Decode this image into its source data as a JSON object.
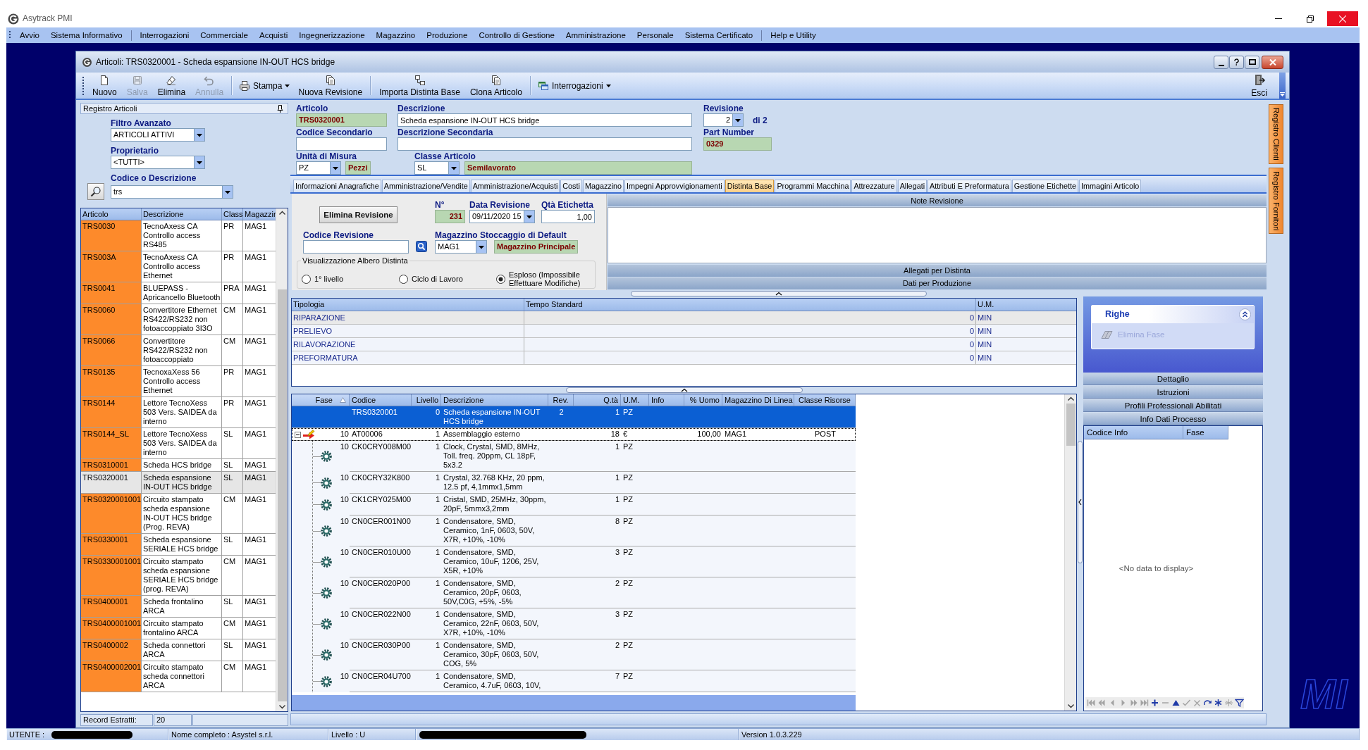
{
  "app": {
    "title": "Asytrack PMI"
  },
  "menu": [
    [
      "Avvio",
      "Sistema Informativo"
    ],
    [
      "Interrogazioni",
      "Commerciale",
      "Acquisti",
      "Ingegnerizzazione",
      "Magazzino",
      "Produzione",
      "Controllo di Gestione",
      "Amministrazione",
      "Personale",
      "Sistema Certificato"
    ],
    [
      "Help e Utility"
    ]
  ],
  "desktop_logo": "MI",
  "window": {
    "title": "Articoli: TRS0320001 - Scheda espansione IN-OUT HCS bridge"
  },
  "toolbar": {
    "groups": [
      [
        {
          "label": "Nuovo",
          "kind": "button",
          "disabled": false
        },
        {
          "label": "Salva",
          "kind": "button",
          "disabled": true
        },
        {
          "label": "Elimina",
          "kind": "button",
          "disabled": false
        },
        {
          "label": "Annulla",
          "kind": "button",
          "disabled": true
        }
      ],
      [
        {
          "label": "Stampa",
          "kind": "dropdown",
          "disabled": false
        },
        {
          "label": "Nuova Revisione",
          "kind": "button",
          "disabled": false
        }
      ],
      [
        {
          "label": "Importa Distinta Base",
          "kind": "button",
          "disabled": false
        },
        {
          "label": "Clona Articolo",
          "kind": "button",
          "disabled": false
        }
      ],
      [
        {
          "label": "Interrogazioni",
          "kind": "dropdown",
          "disabled": false
        }
      ]
    ],
    "exit": "Esci"
  },
  "registry": {
    "title": "Registro Articoli",
    "filters": [
      {
        "kind": "combo",
        "label": "Filtro Avanzato",
        "value": "ARTICOLI ATTIVI"
      },
      {
        "kind": "combo",
        "label": "Proprietario",
        "value": "<TUTTI>"
      },
      {
        "kind": "search",
        "label": "Codice o Descrizione",
        "value": "trs"
      }
    ],
    "columns": [
      "Articolo",
      "Descrizione",
      "Class",
      "Magazzir"
    ],
    "rows": [
      {
        "code": "TRS0030",
        "description": "TecnoAxess CA Controllo access RS485",
        "class_code": "PR",
        "warehouse": "MAG1",
        "selected": false
      },
      {
        "code": "TRS003A",
        "description": "TecnoAxess CA Controllo access Ethernet",
        "class_code": "PR",
        "warehouse": "MAG1",
        "selected": false
      },
      {
        "code": "TRS0041",
        "description": "BLUEPASS - Apricancello Bluetooth",
        "class_code": "PRA",
        "warehouse": "MAG1",
        "selected": false
      },
      {
        "code": "TRS0060",
        "description": "Convertitore Ethernet RS422/RS232 non fotoaccoppiato 3I3O",
        "class_code": "CM",
        "warehouse": "MAG1",
        "selected": false
      },
      {
        "code": "TRS0066",
        "description": "Convertitore RS422/RS232 non fotoaccoppiato",
        "class_code": "CM",
        "warehouse": "MAG1",
        "selected": false
      },
      {
        "code": "TRS0135",
        "description": "TecnoxaXess 56 Controllo access Ethernet",
        "class_code": "PR",
        "warehouse": "MAG1",
        "selected": false
      },
      {
        "code": "TRS0144",
        "description": "Lettore TecnoXess 503 Vers. SAIDEA da interno",
        "class_code": "PR",
        "warehouse": "MAG1",
        "selected": false
      },
      {
        "code": "TRS0144_SL",
        "description": "Lettore TecnoXess 503 Vers. SAIDEA da interno",
        "class_code": "SL",
        "warehouse": "MAG1",
        "selected": false
      },
      {
        "code": "TRS0310001",
        "description": "Scheda HCS bridge",
        "class_code": "SL",
        "warehouse": "MAG1",
        "selected": false
      },
      {
        "code": "TRS0320001",
        "description": "Scheda espansione IN-OUT HCS bridge",
        "class_code": "SL",
        "warehouse": "MAG1",
        "selected": true
      },
      {
        "code": "TRS0320001001",
        "description": "Circuito stampato scheda espansione IN-OUT HCS bridge (Prog. REVA)",
        "class_code": "CM",
        "warehouse": "MAG1",
        "selected": false
      },
      {
        "code": "TRS0330001",
        "description": "Scheda espansione SERIALE HCS bridge",
        "class_code": "SL",
        "warehouse": "MAG1",
        "selected": false
      },
      {
        "code": "TRS0330001001",
        "description": "Circuito stampato scheda espansione SERIALE HCS bridge (prog. REVA)",
        "class_code": "CM",
        "warehouse": "MAG1",
        "selected": false
      },
      {
        "code": "TRS0400001",
        "description": "Scheda frontalino ARCA",
        "class_code": "SL",
        "warehouse": "MAG1",
        "selected": false
      },
      {
        "code": "TRS0400001001",
        "description": "Circuito stampato frontalino ARCA",
        "class_code": "CM",
        "warehouse": "MAG1",
        "selected": false
      },
      {
        "code": "TRS0400002",
        "description": "Scheda connettori ARCA",
        "class_code": "SL",
        "warehouse": "MAG1",
        "selected": false
      },
      {
        "code": "TRS0400002001",
        "description": "Circuito stampato scheda connettori ARCA",
        "class_code": "CM",
        "warehouse": "MAG1",
        "selected": false
      }
    ],
    "footer": {
      "label": "Record Estratti:",
      "value": "20"
    }
  },
  "article": {
    "code": {
      "label": "Articolo",
      "value": "TRS0320001"
    },
    "description": {
      "label": "Descrizione",
      "value": "Scheda espansione IN-OUT HCS bridge"
    },
    "revision": {
      "label": "Revisione",
      "value": "2",
      "of": "di 2"
    },
    "secondary_code": {
      "label": "Codice Secondario"
    },
    "secondary_description": {
      "label": "Descrizione Secondaria"
    },
    "part_number": {
      "label": "Part Number",
      "value": "0329"
    },
    "unit": {
      "label": "Unità di Misura",
      "value": "PZ",
      "name": "Pezzi"
    },
    "item_class": {
      "label": "Classe Articolo",
      "value": "SL",
      "name": "Semilavorato"
    }
  },
  "side_tabs": [
    "Registro Clienti",
    "Registro Fornitori"
  ],
  "tabs": [
    {
      "label": "Informazioni Anagrafiche",
      "selected": false
    },
    {
      "label": "Amministrazione/Vendite",
      "selected": false
    },
    {
      "label": "Amministrazione/Acquisti",
      "selected": false
    },
    {
      "label": "Costi",
      "selected": false
    },
    {
      "label": "Magazzino",
      "selected": false
    },
    {
      "label": "Impegni Approvvigionamenti",
      "selected": false
    },
    {
      "label": "Distinta Base",
      "selected": true
    },
    {
      "label": "Programmi Macchina",
      "selected": false
    },
    {
      "label": "Attrezzature",
      "selected": false
    },
    {
      "label": "Allegati",
      "selected": false
    },
    {
      "label": "Attributi E Preformatura",
      "selected": false
    },
    {
      "label": "Gestione Etichette",
      "selected": false
    },
    {
      "label": "Immagini Articolo",
      "selected": false
    }
  ],
  "revision": {
    "delete_button": "Elimina Revisione",
    "number": {
      "label": "N°",
      "value": "231"
    },
    "date": {
      "label": "Data Revisione",
      "value": "09/11/2020 15"
    },
    "label_qty": {
      "label": "Qtà Etichetta",
      "value": "1,00"
    },
    "code": {
      "label": "Codice Revisione"
    },
    "warehouse": {
      "label": "Magazzino Stoccaggio di Default",
      "value": "MAG1",
      "name": "Magazzino Principale"
    },
    "view": {
      "title": "Visualizzazione Albero Distinta",
      "options": [
        {
          "label": "1° livello",
          "selected": false
        },
        {
          "label": "Ciclo di Lavoro",
          "selected": false
        },
        {
          "label": "Esploso (Impossibile Effettuare Modifiche)",
          "selected": true
        }
      ]
    }
  },
  "notes": {
    "title": "Note Revisione",
    "sections": [
      "Allegati per Distinta",
      "Dati per Produzione"
    ]
  },
  "times": {
    "columns": [
      "Tipologia",
      "Tempo Standard",
      "U.M."
    ],
    "rows": [
      {
        "type": "RIPARAZIONE",
        "time": "0",
        "unit": "MIN",
        "selected": true
      },
      {
        "type": "PRELIEVO",
        "time": "0",
        "unit": "MIN",
        "selected": false
      },
      {
        "type": "RILAVORAZIONE",
        "time": "0",
        "unit": "MIN",
        "selected": false
      },
      {
        "type": "PREFORMATURA",
        "time": "0",
        "unit": "MIN",
        "selected": false
      }
    ]
  },
  "bom": {
    "columns": [
      {
        "label": "Fase",
        "sorted": true
      },
      {
        "label": "Codice",
        "sorted": false
      },
      {
        "label": "Livello",
        "sorted": false
      },
      {
        "label": "Descrizione",
        "sorted": false
      },
      {
        "label": "Rev.",
        "sorted": false
      },
      {
        "label": "Q.tà",
        "sorted": false
      },
      {
        "label": "U.M.",
        "sorted": false
      },
      {
        "label": "Info",
        "sorted": false
      },
      {
        "label": "% Uomo",
        "sorted": false
      },
      {
        "label": "Magazzino Di Linea",
        "sorted": false
      },
      {
        "label": "Classe Risorse",
        "sorted": false
      }
    ],
    "rows": [
      {
        "kind": "article",
        "code": "TRS0320001",
        "livello": "0",
        "description": "Scheda espansione IN-OUT HCS bridge",
        "rev": "2",
        "qty": "1",
        "unit": "PZ",
        "selected": true,
        "focused": false,
        "children": [
          {
            "kind": "operation",
            "phase": "10",
            "code": "AT00006",
            "livello": "1",
            "description": "Assemblaggio esterno",
            "qty": "18",
            "unit": "€",
            "labor": "100,00",
            "line_warehouse": "MAG1",
            "resource_class": "POST",
            "selected": false,
            "focused": true,
            "expanded": true,
            "children": [
              {
                "kind": "component",
                "phase": "10",
                "code": "CK0CRY008M00",
                "livello": "1",
                "description": "Clock, Crystal, SMD, 8MHz, Toll. freq. 20ppm, CL 18pF, 5x3.2",
                "qty": "1",
                "unit": "PZ",
                "selected": false,
                "focused": false
              },
              {
                "kind": "component",
                "phase": "10",
                "code": "CK0CRY32K800",
                "livello": "1",
                "description": "Crystal, 32.768 KHz, 20 ppm, 12.5 pf, 4,1mmx1,5mm",
                "qty": "1",
                "unit": "PZ",
                "selected": false,
                "focused": false
              },
              {
                "kind": "component",
                "phase": "10",
                "code": "CK1CRY025M00",
                "livello": "1",
                "description": "Cristal, SMD, 25MHz, 30ppm, 20pF, 5mmx3,2mm",
                "qty": "1",
                "unit": "PZ",
                "selected": false,
                "focused": false
              },
              {
                "kind": "component",
                "phase": "10",
                "code": "CN0CER001N00",
                "livello": "1",
                "description": "Condensatore, SMD, Ceramico, 1nF, 0603, 50V, X7R, +10%, -10%",
                "qty": "8",
                "unit": "PZ",
                "selected": false,
                "focused": false
              },
              {
                "kind": "component",
                "phase": "10",
                "code": "CN0CER010U00",
                "livello": "1",
                "description": "Condensatore, SMD, Ceramico, 10uF, 1206, 25V, X5R, +10%",
                "qty": "3",
                "unit": "PZ",
                "selected": false,
                "focused": false
              },
              {
                "kind": "component",
                "phase": "10",
                "code": "CN0CER020P00",
                "livello": "1",
                "description": "Condensatore, SMD, Ceramico, 20pF, 0603, 50V,C0G, +5%, -5%",
                "qty": "2",
                "unit": "PZ",
                "selected": false,
                "focused": false
              },
              {
                "kind": "component",
                "phase": "10",
                "code": "CN0CER022N00",
                "livello": "1",
                "description": "Condensatore, SMD, Ceramico, 22nF, 0603, 50V, X7R, +10%, -10%",
                "qty": "3",
                "unit": "PZ",
                "selected": false,
                "focused": false
              },
              {
                "kind": "component",
                "phase": "10",
                "code": "CN0CER030P00",
                "livello": "1",
                "description": "Condensatore, SMD, Ceramico, 30pF, 0603, 50V, COG, 5%",
                "qty": "2",
                "unit": "PZ",
                "selected": false,
                "focused": false
              },
              {
                "kind": "component",
                "phase": "10",
                "code": "CN0CER04U700",
                "livello": "1",
                "description": "Condensatore, SMD, Ceramico, 4.7uF, 0603, 10V,",
                "qty": "7",
                "unit": "PZ",
                "selected": false,
                "focused": false
              }
            ]
          }
        ]
      }
    ]
  },
  "tasks": {
    "title": "Righe",
    "expanded": true,
    "items": [
      {
        "label": "Elimina Fase",
        "disabled": true
      }
    ]
  },
  "pane_sections": [
    "Dettaglio",
    "Istruzioni",
    "Profili Professionali Abilitati",
    "Info Dati Processo"
  ],
  "info_grid": {
    "columns": [
      "Codice Info",
      "Fase"
    ],
    "empty_text": "<No data to display>",
    "navigator": [
      {
        "disabled": true
      },
      {
        "disabled": true
      },
      {
        "disabled": true
      },
      {
        "disabled": true
      },
      {
        "disabled": true
      },
      {
        "disabled": true
      },
      {
        "disabled": false
      },
      {
        "disabled": true
      },
      {
        "disabled": false
      },
      {
        "disabled": true
      },
      {
        "disabled": true
      },
      {
        "disabled": false
      },
      {
        "disabled": false
      },
      {
        "disabled": true
      },
      {
        "disabled": false
      }
    ]
  },
  "status_bar": [
    {
      "text": "UTENTE :",
      "redacted": true
    },
    {
      "text": "Nome completo : Asystel s.r.l.",
      "redacted": false
    },
    {
      "text": "Livello : U",
      "redacted": false
    },
    {
      "redacted": true
    },
    {
      "text": "Version 1.0.3.229",
      "redacted": false
    }
  ]
}
